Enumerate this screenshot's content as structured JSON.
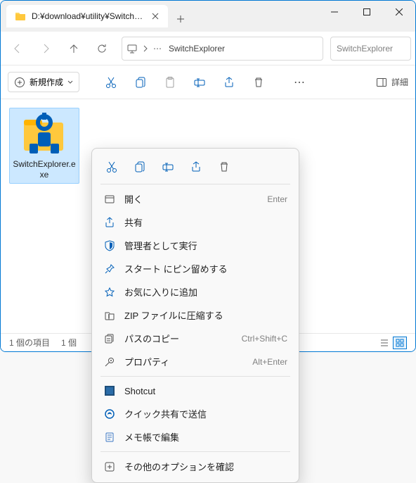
{
  "colors": {
    "accent": "#0078d4",
    "folder": "#ffc83d",
    "icon": "#005fb8"
  },
  "titlebar": {
    "tab_label": "D:¥download¥utility¥SwitchEx"
  },
  "address": {
    "crumb": "SwitchExplorer",
    "search_placeholder": "SwitchExplorer"
  },
  "toolbar": {
    "new_label": "新規作成",
    "details_label": "詳細"
  },
  "file": {
    "name": "SwitchExplorer.exe"
  },
  "status": {
    "count": "1 個の項目",
    "selected": "1 個"
  },
  "ctx": {
    "items": [
      {
        "label": "開く",
        "accel": "Enter",
        "icon": "open"
      },
      {
        "label": "共有",
        "accel": "",
        "icon": "share"
      },
      {
        "label": "管理者として実行",
        "accel": "",
        "icon": "admin"
      },
      {
        "label": "スタート にピン留めする",
        "accel": "",
        "icon": "pin"
      },
      {
        "label": "お気に入りに追加",
        "accel": "",
        "icon": "star"
      },
      {
        "label": "ZIP ファイルに圧縮する",
        "accel": "",
        "icon": "zip"
      },
      {
        "label": "パスのコピー",
        "accel": "Ctrl+Shift+C",
        "icon": "copypath"
      },
      {
        "label": "プロパティ",
        "accel": "Alt+Enter",
        "icon": "props"
      }
    ],
    "appitems": [
      {
        "label": "Shotcut",
        "icon": "shotcut"
      },
      {
        "label": "クイック共有で送信",
        "icon": "quickshare"
      },
      {
        "label": "メモ帳で編集",
        "icon": "notepad"
      }
    ],
    "more": "その他のオプションを確認"
  }
}
